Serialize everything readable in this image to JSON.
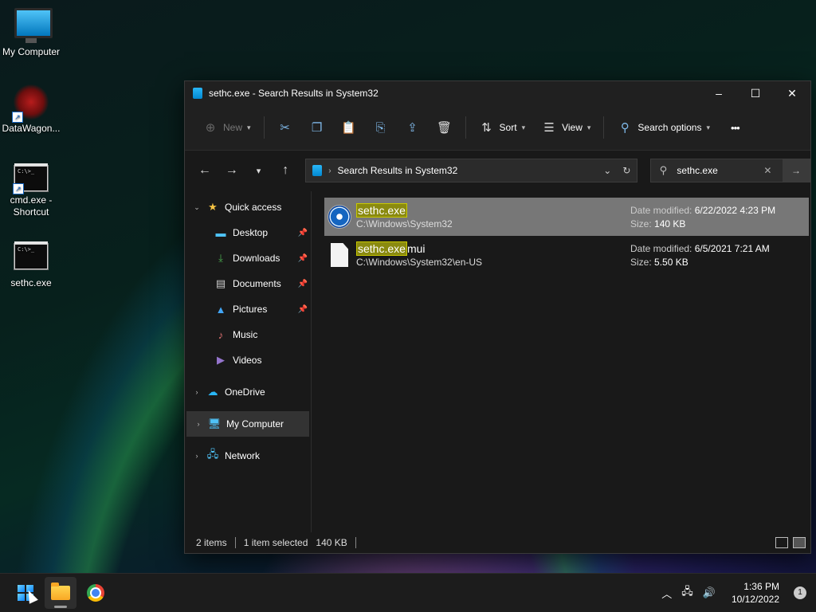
{
  "desktop": {
    "icons": [
      {
        "label": "My Computer"
      },
      {
        "label": "DataWagon..."
      },
      {
        "label": "cmd.exe -\nShortcut",
        "label1": "cmd.exe -",
        "label2": "Shortcut"
      },
      {
        "label": "sethc.exe"
      }
    ],
    "cmd_prompt_text": "C:\\>_"
  },
  "window": {
    "title": "sethc.exe - Search Results in System32",
    "controls": {
      "minimize": "–",
      "maximize": "☐",
      "close": "✕"
    },
    "toolbar": {
      "new_label": "New",
      "sort_label": "Sort",
      "view_label": "View",
      "search_options_label": "Search options",
      "more_label": "•••"
    },
    "address": {
      "breadcrumb": "Search Results in System32"
    },
    "search": {
      "value": "sethc.exe"
    },
    "nav": {
      "quick_access": "Quick access",
      "items": [
        "Desktop",
        "Downloads",
        "Documents",
        "Pictures",
        "Music",
        "Videos"
      ],
      "onedrive": "OneDrive",
      "my_computer": "My Computer",
      "network": "Network"
    },
    "files": [
      {
        "name_match": "sethc.exe",
        "name_rest": "",
        "path": "C:\\Windows\\System32",
        "date_label": "Date modified:",
        "date": "6/22/2022 4:23 PM",
        "size_label": "Size:",
        "size": "140 KB",
        "selected": true
      },
      {
        "name_match": "sethc.exe",
        "name_rest": "mui",
        "path": "C:\\Windows\\System32\\en-US",
        "date_label": "Date modified:",
        "date": "6/5/2021 7:21 AM",
        "size_label": "Size:",
        "size": "5.50 KB",
        "selected": false
      }
    ],
    "status": {
      "items_count": "2 items",
      "selection": "1 item selected",
      "selection_size": "140 KB"
    }
  },
  "taskbar": {
    "time": "1:36 PM",
    "date": "10/12/2022",
    "notification_count": "1"
  }
}
